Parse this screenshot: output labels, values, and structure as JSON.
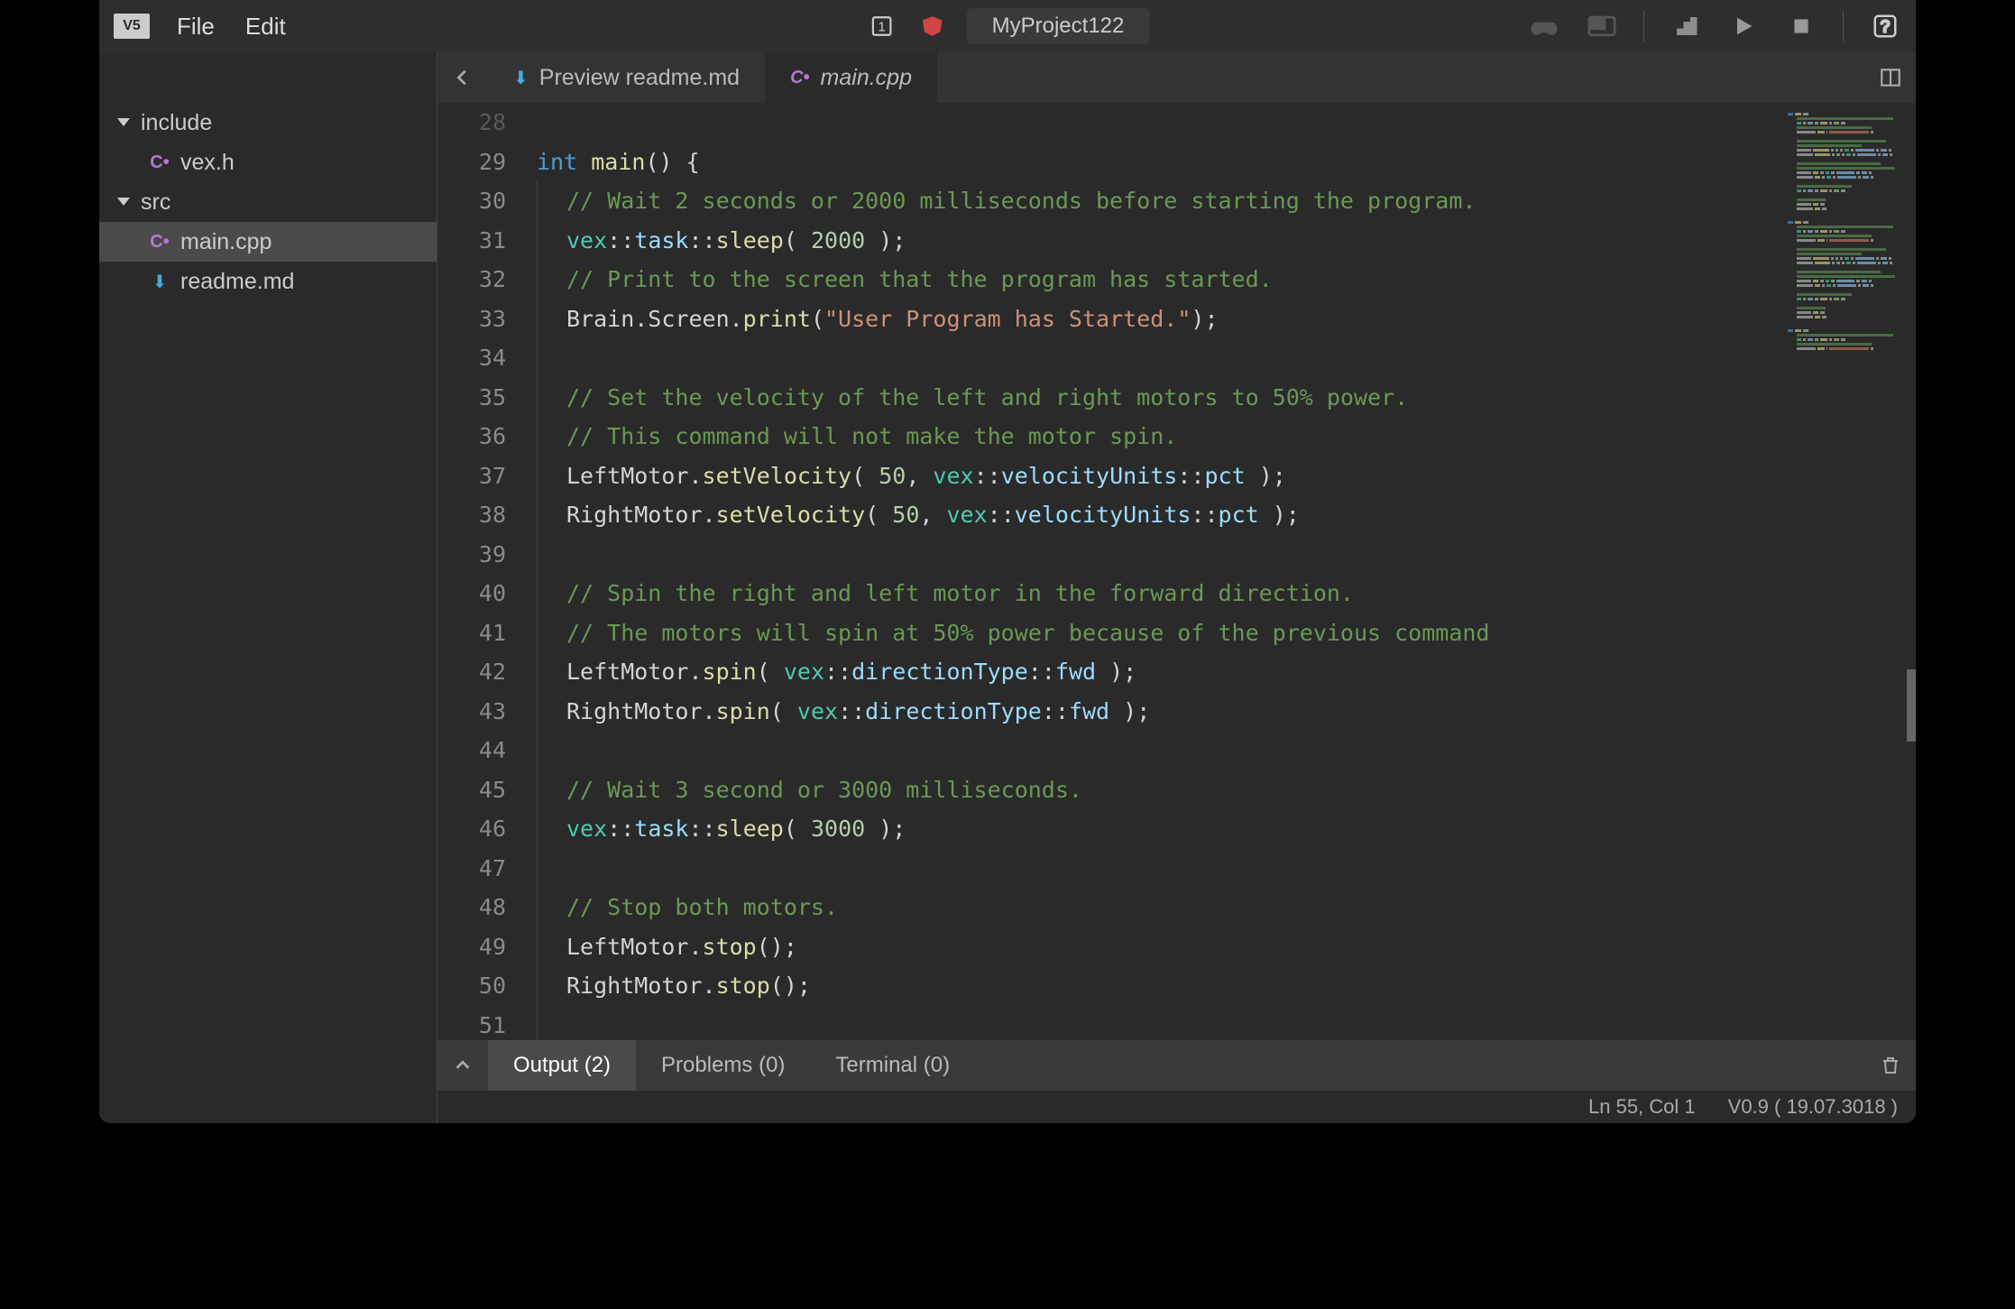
{
  "header": {
    "logo": "V5",
    "menus": [
      "File",
      "Edit"
    ],
    "project_name": "MyProject122",
    "badge_number": "1"
  },
  "sidebar": {
    "folders": [
      {
        "name": "include",
        "files": [
          {
            "name": "vex.h",
            "icon": "cpp"
          }
        ]
      },
      {
        "name": "src",
        "files": [
          {
            "name": "main.cpp",
            "icon": "cpp",
            "active": true
          },
          {
            "name": "readme.md",
            "icon": "md"
          }
        ]
      }
    ]
  },
  "tabs": {
    "items": [
      {
        "label": "Preview readme.md",
        "icon": "md",
        "active": false
      },
      {
        "label": "main.cpp",
        "icon": "cpp",
        "active": true
      }
    ]
  },
  "code": {
    "first_line": 28,
    "lines": [
      [
        {
          "t": ""
        }
      ],
      [
        {
          "t": "int ",
          "c": "tok-kw"
        },
        {
          "t": "main",
          "c": "tok-fn"
        },
        {
          "t": "() {",
          "c": "tok-punc"
        }
      ],
      [
        {
          "t": "// Wait 2 seconds or 2000 milliseconds before starting the program.",
          "c": "tok-comment",
          "i": 1
        }
      ],
      [
        {
          "t": "vex",
          "c": "tok-ns",
          "i": 1
        },
        {
          "t": "::",
          "c": "tok-punc"
        },
        {
          "t": "task",
          "c": "tok-member"
        },
        {
          "t": "::",
          "c": "tok-punc"
        },
        {
          "t": "sleep",
          "c": "tok-fn"
        },
        {
          "t": "( ",
          "c": "tok-punc"
        },
        {
          "t": "2000",
          "c": "tok-num"
        },
        {
          "t": " );",
          "c": "tok-punc"
        }
      ],
      [
        {
          "t": "// Print to the screen that the program has started.",
          "c": "tok-comment",
          "i": 1
        }
      ],
      [
        {
          "t": "Brain.Screen.",
          "c": "tok-punc",
          "i": 1
        },
        {
          "t": "print",
          "c": "tok-fn"
        },
        {
          "t": "(",
          "c": "tok-punc"
        },
        {
          "t": "\"User Program has Started.\"",
          "c": "tok-str"
        },
        {
          "t": ");",
          "c": "tok-punc"
        }
      ],
      [
        {
          "t": "",
          "i": 1
        }
      ],
      [
        {
          "t": "// Set the velocity of the left and right motors to 50% power.",
          "c": "tok-comment",
          "i": 1
        }
      ],
      [
        {
          "t": "// This command will not make the motor spin.",
          "c": "tok-comment",
          "i": 1
        }
      ],
      [
        {
          "t": "LeftMotor.",
          "c": "tok-punc",
          "i": 1
        },
        {
          "t": "setVelocity",
          "c": "tok-fn"
        },
        {
          "t": "( ",
          "c": "tok-punc"
        },
        {
          "t": "50",
          "c": "tok-num"
        },
        {
          "t": ", ",
          "c": "tok-punc"
        },
        {
          "t": "vex",
          "c": "tok-ns"
        },
        {
          "t": "::",
          "c": "tok-punc"
        },
        {
          "t": "velocityUnits",
          "c": "tok-member"
        },
        {
          "t": "::",
          "c": "tok-punc"
        },
        {
          "t": "pct ",
          "c": "tok-member"
        },
        {
          "t": ");",
          "c": "tok-punc"
        }
      ],
      [
        {
          "t": "RightMotor.",
          "c": "tok-punc",
          "i": 1
        },
        {
          "t": "setVelocity",
          "c": "tok-fn"
        },
        {
          "t": "( ",
          "c": "tok-punc"
        },
        {
          "t": "50",
          "c": "tok-num"
        },
        {
          "t": ", ",
          "c": "tok-punc"
        },
        {
          "t": "vex",
          "c": "tok-ns"
        },
        {
          "t": "::",
          "c": "tok-punc"
        },
        {
          "t": "velocityUnits",
          "c": "tok-member"
        },
        {
          "t": "::",
          "c": "tok-punc"
        },
        {
          "t": "pct ",
          "c": "tok-member"
        },
        {
          "t": ");",
          "c": "tok-punc"
        }
      ],
      [
        {
          "t": "",
          "i": 1
        }
      ],
      [
        {
          "t": "// Spin the right and left motor in the forward direction.",
          "c": "tok-comment",
          "i": 1
        }
      ],
      [
        {
          "t": "// The motors will spin at 50% power because of the previous command",
          "c": "tok-comment",
          "i": 1
        }
      ],
      [
        {
          "t": "LeftMotor.",
          "c": "tok-punc",
          "i": 1
        },
        {
          "t": "spin",
          "c": "tok-fn"
        },
        {
          "t": "( ",
          "c": "tok-punc"
        },
        {
          "t": "vex",
          "c": "tok-ns"
        },
        {
          "t": "::",
          "c": "tok-punc"
        },
        {
          "t": "directionType",
          "c": "tok-member"
        },
        {
          "t": "::",
          "c": "tok-punc"
        },
        {
          "t": "fwd ",
          "c": "tok-member"
        },
        {
          "t": ");",
          "c": "tok-punc"
        }
      ],
      [
        {
          "t": "RightMotor.",
          "c": "tok-punc",
          "i": 1
        },
        {
          "t": "spin",
          "c": "tok-fn"
        },
        {
          "t": "( ",
          "c": "tok-punc"
        },
        {
          "t": "vex",
          "c": "tok-ns"
        },
        {
          "t": "::",
          "c": "tok-punc"
        },
        {
          "t": "directionType",
          "c": "tok-member"
        },
        {
          "t": "::",
          "c": "tok-punc"
        },
        {
          "t": "fwd ",
          "c": "tok-member"
        },
        {
          "t": ");",
          "c": "tok-punc"
        }
      ],
      [
        {
          "t": "",
          "i": 1
        }
      ],
      [
        {
          "t": "// Wait 3 second or 3000 milliseconds.",
          "c": "tok-comment",
          "i": 1
        }
      ],
      [
        {
          "t": "vex",
          "c": "tok-ns",
          "i": 1
        },
        {
          "t": "::",
          "c": "tok-punc"
        },
        {
          "t": "task",
          "c": "tok-member"
        },
        {
          "t": "::",
          "c": "tok-punc"
        },
        {
          "t": "sleep",
          "c": "tok-fn"
        },
        {
          "t": "( ",
          "c": "tok-punc"
        },
        {
          "t": "3000",
          "c": "tok-num"
        },
        {
          "t": " );",
          "c": "tok-punc"
        }
      ],
      [
        {
          "t": "",
          "i": 1
        }
      ],
      [
        {
          "t": "// Stop both motors.",
          "c": "tok-comment",
          "i": 1
        }
      ],
      [
        {
          "t": "LeftMotor.",
          "c": "tok-punc",
          "i": 1
        },
        {
          "t": "stop",
          "c": "tok-fn"
        },
        {
          "t": "();",
          "c": "tok-punc"
        }
      ],
      [
        {
          "t": "RightMotor.",
          "c": "tok-punc",
          "i": 1
        },
        {
          "t": "stop",
          "c": "tok-fn"
        },
        {
          "t": "();",
          "c": "tok-punc"
        }
      ],
      [
        {
          "t": "",
          "i": 1
        }
      ]
    ]
  },
  "bottom_panel": {
    "tabs": [
      {
        "label": "Output (2)",
        "active": true
      },
      {
        "label": "Problems (0)",
        "active": false
      },
      {
        "label": "Terminal (0)",
        "active": false
      }
    ]
  },
  "status": {
    "cursor": "Ln 55, Col 1",
    "version": "V0.9 ( 19.07.3018 )"
  }
}
